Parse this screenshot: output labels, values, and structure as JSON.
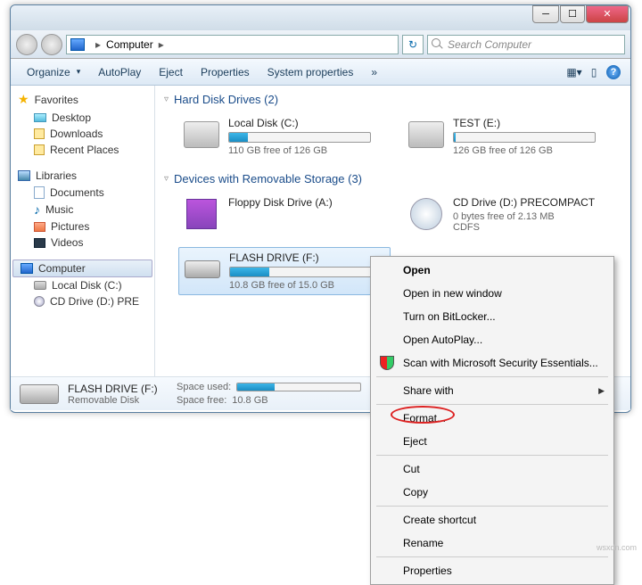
{
  "window": {
    "min": "─",
    "max": "☐",
    "close": "✕"
  },
  "address": {
    "location": "Computer",
    "arrow": "▸",
    "search_placeholder": "Search Computer",
    "refresh": "↻"
  },
  "toolbar": {
    "organize": "Organize",
    "autoplay": "AutoPlay",
    "eject": "Eject",
    "properties": "Properties",
    "system_properties": "System properties",
    "overflow": "»",
    "help": "?"
  },
  "sidebar": {
    "favorites": "Favorites",
    "fav_items": [
      {
        "label": "Desktop"
      },
      {
        "label": "Downloads"
      },
      {
        "label": "Recent Places"
      }
    ],
    "libraries": "Libraries",
    "lib_items": [
      {
        "label": "Documents"
      },
      {
        "label": "Music"
      },
      {
        "label": "Pictures"
      },
      {
        "label": "Videos"
      }
    ],
    "computer": "Computer",
    "comp_items": [
      {
        "label": "Local Disk (C:)"
      },
      {
        "label": "CD Drive (D:) PRE"
      }
    ]
  },
  "content": {
    "section_hdd": "Hard Disk Drives (2)",
    "section_removable": "Devices with Removable Storage (3)",
    "drives_hdd": [
      {
        "label": "Local Disk (C:)",
        "free": "110 GB free of 126 GB",
        "fill": 13
      },
      {
        "label": "TEST (E:)",
        "free": "126 GB free of 126 GB",
        "fill": 1
      }
    ],
    "drives_rem": [
      {
        "label": "Floppy Disk Drive (A:)",
        "free": "",
        "type": "floppy"
      },
      {
        "label": "CD Drive (D:) PRECOMPACT",
        "free": "0 bytes free of 2.13 MB",
        "extra": "CDFS",
        "type": "disc"
      },
      {
        "label": "FLASH DRIVE (F:)",
        "free": "10.8 GB free of 15.0 GB",
        "fill": 28,
        "type": "usb",
        "selected": true
      }
    ]
  },
  "details": {
    "name": "FLASH DRIVE (F:)",
    "type": "Removable Disk",
    "used_label": "Space used:",
    "free_label": "Space free:",
    "free_value": "10.8 GB"
  },
  "context_menu": {
    "items": [
      {
        "label": "Open",
        "bold": true
      },
      {
        "label": "Open in new window"
      },
      {
        "label": "Turn on BitLocker..."
      },
      {
        "label": "Open AutoPlay..."
      },
      {
        "label": "Scan with Microsoft Security Essentials...",
        "icon": "shield"
      },
      {
        "sep": true
      },
      {
        "label": "Share with",
        "submenu": true
      },
      {
        "sep": true
      },
      {
        "label": "Format...",
        "highlight": true
      },
      {
        "label": "Eject"
      },
      {
        "sep": true
      },
      {
        "label": "Cut"
      },
      {
        "label": "Copy"
      },
      {
        "sep": true
      },
      {
        "label": "Create shortcut"
      },
      {
        "label": "Rename"
      },
      {
        "sep": true
      },
      {
        "label": "Properties"
      }
    ]
  },
  "watermark": "wsxdn.com"
}
